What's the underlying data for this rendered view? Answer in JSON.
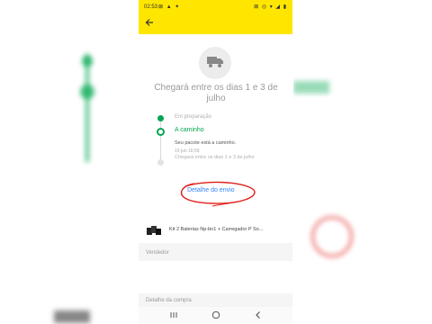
{
  "status_bar": {
    "time": "02:53",
    "left_icons": "⊠ ▲ ✦",
    "right_icons": "⊠ ◎ ▾ ◢ ▮"
  },
  "header": {
    "back_icon": "arrow-left-icon"
  },
  "shipment": {
    "headline": "Chegará entre os dias 1 e 3 de julho",
    "steps": {
      "prep_label": "Em preparação",
      "current_label": "A caminho",
      "current_desc": "Seu pacote está a caminho.",
      "current_time": "19 jun 16:59",
      "eta_text": "Chegará entre os dias 1 e 3 de julho"
    },
    "detail_link": "Detalhe do envio"
  },
  "product": {
    "title": "Kit 2 Baterias Np-bn1 + Carregador P So..."
  },
  "sections": {
    "seller_label": "Vendedor",
    "purchase_label": "Detalhe da compra"
  },
  "colors": {
    "brand_yellow": "#ffe600",
    "success_green": "#00a650",
    "link_blue": "#3483fa",
    "annotation_red": "#e0201a"
  },
  "nav": {
    "recents_icon": "recents-icon",
    "home_icon": "home-icon",
    "back_icon": "nav-back-icon"
  }
}
